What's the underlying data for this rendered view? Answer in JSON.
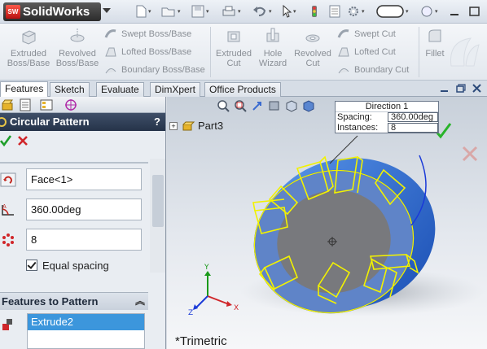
{
  "app": {
    "logo_text": "SolidWorks",
    "logo_mark": "SW"
  },
  "ribbon": {
    "extruded_boss": "Extruded Boss/Base",
    "revolved_boss": "Revolved Boss/Base",
    "swept_boss": "Swept Boss/Base",
    "lofted_boss": "Lofted Boss/Base",
    "boundary_boss": "Boundary Boss/Base",
    "extruded_cut": "Extruded Cut",
    "hole_wizard": "Hole Wizard",
    "revolved_cut": "Revolved Cut",
    "swept_cut": "Swept Cut",
    "lofted_cut": "Lofted Cut",
    "boundary_cut": "Boundary Cut",
    "fillet": "Fillet"
  },
  "tabs": [
    "Features",
    "Sketch",
    "Evaluate",
    "DimXpert",
    "Office Products"
  ],
  "active_tab": "Features",
  "property_manager": {
    "title": "Circular Pattern",
    "help": "?",
    "axis_value": "Face<1>",
    "angle_value": "360.00deg",
    "instances_value": "8",
    "equal_spacing_label": "Equal spacing",
    "equal_spacing_checked": true,
    "features_to_pattern_header": "Features to Pattern",
    "features_to_pattern_items": [
      "Extrude2"
    ]
  },
  "graphics": {
    "tree_part": "Part3",
    "view_name": "*Trimetric",
    "direction_callout": {
      "title": "Direction 1",
      "spacing_label": "Spacing:",
      "spacing_value": "360.00deg",
      "instances_label": "Instances:",
      "instances_value": "8"
    }
  },
  "colors": {
    "part_blue": "#2f6fd0",
    "preview_yellow": "#f2f200",
    "pm_header": "#2e3c55",
    "selection": "#3c96dc",
    "ok_green": "#1e9e2a",
    "cancel_red": "#d0262a"
  }
}
